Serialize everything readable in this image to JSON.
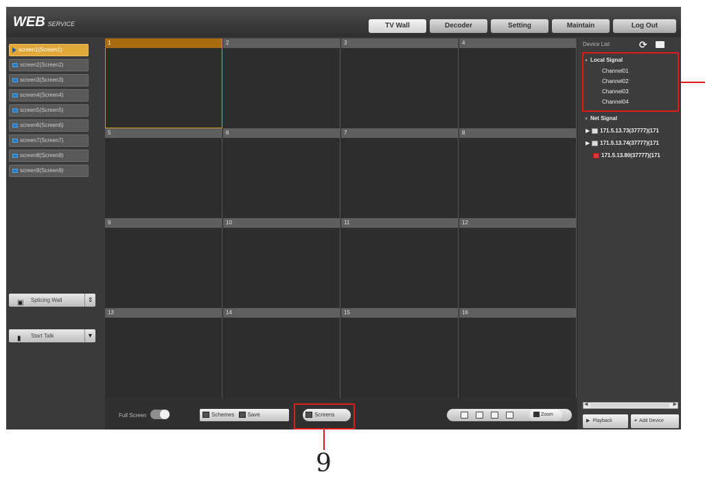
{
  "header": {
    "logo": "WEB",
    "logo_sub": "SERVICE",
    "tabs": [
      {
        "label": "TV Wall",
        "active": true
      },
      {
        "label": "Decoder",
        "active": false
      },
      {
        "label": "Setting",
        "active": false
      },
      {
        "label": "Maintain",
        "active": false
      },
      {
        "label": "Log Out",
        "active": false
      }
    ]
  },
  "screens": [
    {
      "label": "screen1(Screen1)",
      "active": true
    },
    {
      "label": "screen2(Screen2)",
      "active": false
    },
    {
      "label": "screen3(Screen3)",
      "active": false
    },
    {
      "label": "screen4(Screen4)",
      "active": false
    },
    {
      "label": "screen5(Screen5)",
      "active": false
    },
    {
      "label": "screen6(Screen6)",
      "active": false
    },
    {
      "label": "screen7(Screen7)",
      "active": false
    },
    {
      "label": "screen8(Screen8)",
      "active": false
    },
    {
      "label": "screen9(Screen9)",
      "active": false
    }
  ],
  "side_controls": {
    "splicing_wall": "Splicing Wall",
    "start_talk": "Start Talk"
  },
  "grid": {
    "cells": [
      "1",
      "2",
      "3",
      "4",
      "5",
      "6",
      "7",
      "8",
      "9",
      "10",
      "11",
      "12",
      "13",
      "14",
      "15",
      "16"
    ],
    "selected": "1"
  },
  "toolbar": {
    "full_screen_label": "Full Screen",
    "full_screen_on": false,
    "schemes_label": "Schemes",
    "save_label": "Save",
    "screens_label": "Screens",
    "zoom_label": "Zoom"
  },
  "device_list": {
    "title": "Device List",
    "local_signal": {
      "label": "Local Signal",
      "channels": [
        "Channel01",
        "Channel02",
        "Channel03",
        "Channel04"
      ]
    },
    "net_signal": {
      "label": "Net Signal",
      "devices": [
        {
          "label": "171.5.13.73(37777)(171",
          "status": "normal",
          "expandable": true
        },
        {
          "label": "171.5.13.74(37777)(171",
          "status": "normal",
          "expandable": true
        },
        {
          "label": "171.5.13.80(37777)(171",
          "status": "offline",
          "expandable": false
        }
      ]
    },
    "playback_label": "Playback",
    "add_device_label": "Add Device"
  },
  "annotation": {
    "callout_number": "9"
  },
  "colors": {
    "accent": "#e0a838",
    "annotation": "#e21a1a"
  }
}
